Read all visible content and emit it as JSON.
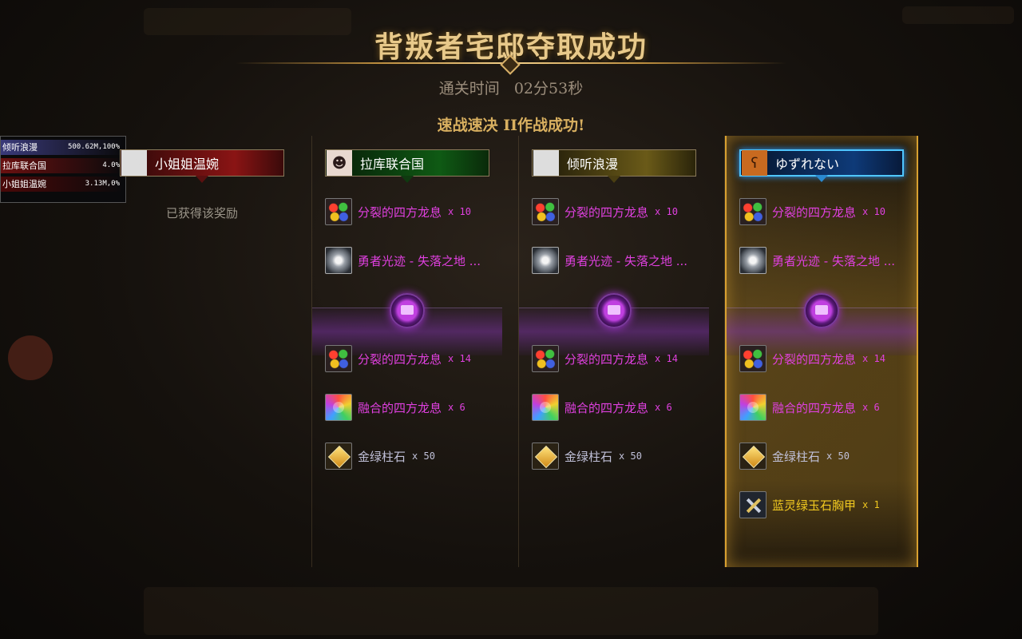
{
  "header": {
    "title": "背叛者宅邸夺取成功",
    "clear_time_label": "通关时间",
    "clear_time_value": "02分53秒",
    "achievement": "速战速决 II作战成功!"
  },
  "damage_panel": {
    "rows": [
      {
        "name": "倾听浪漫",
        "value": "500.62M,100%",
        "color": "#3a3a7a"
      },
      {
        "name": "拉库联合国",
        "value": "4.0%",
        "color": "#6a1010"
      },
      {
        "name": "小姐姐温婉",
        "value": "3.13M,0%",
        "color": "#4a0808"
      }
    ]
  },
  "players": [
    {
      "name": "小姐姐温婉",
      "avatar_icon": "white-hair-avatar-icon",
      "plate": "red",
      "obtained_text": "已获得该奖励",
      "rewards_top": [],
      "rewards_bottom": []
    },
    {
      "name": "拉库联合国",
      "avatar_icon": "dark-hair-avatar-icon",
      "plate": "green",
      "rewards_top": [
        {
          "icon": "split-dragon-breath-icon",
          "name": "分裂的四方龙息",
          "qty": "x 10",
          "kind": "split",
          "tone": "purple"
        },
        {
          "icon": "hero-light-icon",
          "name": "勇者光迹 - 失落之地 ...",
          "qty": "",
          "kind": "light",
          "tone": "purple"
        }
      ],
      "rewards_bottom": [
        {
          "icon": "split-dragon-breath-icon",
          "name": "分裂的四方龙息",
          "qty": "x 14",
          "kind": "split",
          "tone": "purple"
        },
        {
          "icon": "fused-dragon-breath-icon",
          "name": "融合的四方龙息",
          "qty": "x 6",
          "kind": "fused",
          "tone": "purple"
        },
        {
          "icon": "gold-green-stone-icon",
          "name": "金绿柱石",
          "qty": "x 50",
          "kind": "stone",
          "tone": "gray"
        }
      ]
    },
    {
      "name": "倾听浪漫",
      "avatar_icon": "white-hair-avatar-icon",
      "plate": "gold",
      "rewards_top": [
        {
          "icon": "split-dragon-breath-icon",
          "name": "分裂的四方龙息",
          "qty": "x 10",
          "kind": "split",
          "tone": "purple"
        },
        {
          "icon": "hero-light-icon",
          "name": "勇者光迹 - 失落之地 ...",
          "qty": "",
          "kind": "light",
          "tone": "purple"
        }
      ],
      "rewards_bottom": [
        {
          "icon": "split-dragon-breath-icon",
          "name": "分裂的四方龙息",
          "qty": "x 14",
          "kind": "split",
          "tone": "purple"
        },
        {
          "icon": "fused-dragon-breath-icon",
          "name": "融合的四方龙息",
          "qty": "x 6",
          "kind": "fused",
          "tone": "purple"
        },
        {
          "icon": "gold-green-stone-icon",
          "name": "金绿柱石",
          "qty": "x 50",
          "kind": "stone",
          "tone": "gray"
        }
      ]
    },
    {
      "name": "ゆずれない",
      "avatar_icon": "bear-avatar-icon",
      "plate": "blue",
      "highlight": true,
      "rewards_top": [
        {
          "icon": "split-dragon-breath-icon",
          "name": "分裂的四方龙息",
          "qty": "x 10",
          "kind": "split",
          "tone": "purple"
        },
        {
          "icon": "hero-light-icon",
          "name": "勇者光迹 - 失落之地 ...",
          "qty": "",
          "kind": "light",
          "tone": "purple"
        }
      ],
      "rewards_bottom": [
        {
          "icon": "split-dragon-breath-icon",
          "name": "分裂的四方龙息",
          "qty": "x 14",
          "kind": "split",
          "tone": "purple"
        },
        {
          "icon": "fused-dragon-breath-icon",
          "name": "融合的四方龙息",
          "qty": "x 6",
          "kind": "fused",
          "tone": "purple"
        },
        {
          "icon": "gold-green-stone-icon",
          "name": "金绿柱石",
          "qty": "x 50",
          "kind": "stone",
          "tone": "gray"
        },
        {
          "icon": "jade-breastplate-icon",
          "name": "蓝灵绿玉石胸甲",
          "qty": "x 1",
          "kind": "armor",
          "tone": "yellow"
        }
      ]
    }
  ]
}
